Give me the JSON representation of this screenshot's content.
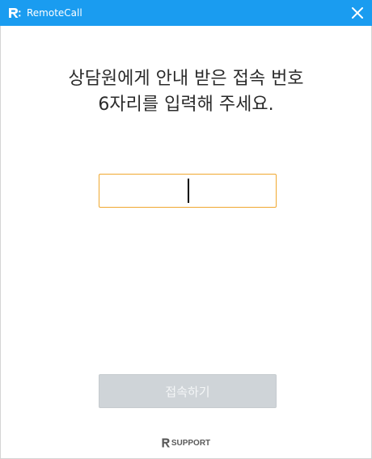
{
  "window": {
    "title": "RemoteCall",
    "accent_color": "#1a9cf0",
    "close_icon": "close-icon",
    "logo_icon": "remotecall-logo-icon"
  },
  "main": {
    "instruction_line1": "상담원에게 안내 받은 접속 번호",
    "instruction_line2": "6자리를 입력해 주세요.",
    "code_input": {
      "value": "",
      "placeholder": ""
    },
    "connect_button_label": "접속하기",
    "connect_button_state": "disabled"
  },
  "footer": {
    "brand_text": "SUPPORT"
  }
}
